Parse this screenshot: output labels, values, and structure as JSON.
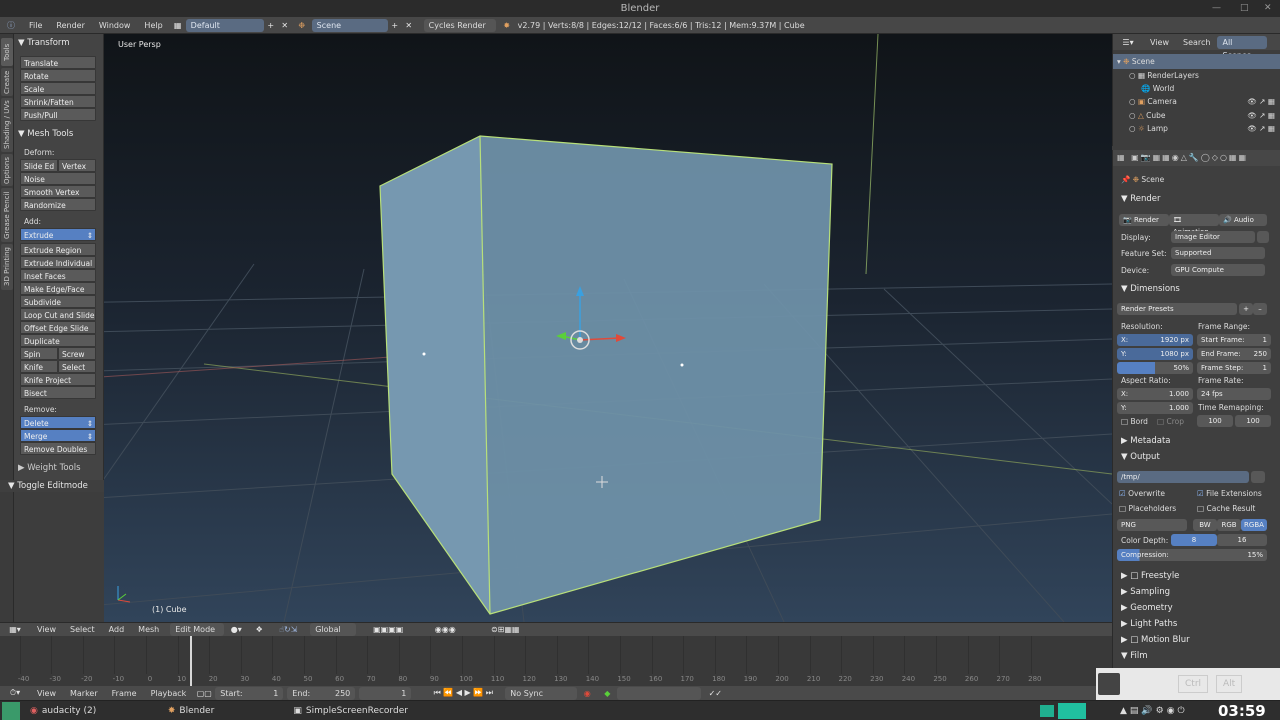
{
  "window": {
    "title": "Blender"
  },
  "infobar": {
    "menus": [
      "File",
      "Render",
      "Window",
      "Help"
    ],
    "layout": "Default",
    "scene": "Scene",
    "engine": "Cycles Render",
    "stats": "v2.79 | Verts:8/8 | Edges:12/12 | Faces:6/6 | Tris:12 | Mem:9.37M | Cube"
  },
  "left_tabs": [
    "Tools",
    "Create",
    "Shading / UVs",
    "Options",
    "Grease Pencil",
    "3D Printing"
  ],
  "toolshelf": {
    "transform_title": "Transform",
    "transform": [
      "Translate",
      "Rotate",
      "Scale",
      "Shrink/Fatten",
      "Push/Pull"
    ],
    "mesh_title": "Mesh Tools",
    "deform_label": "Deform:",
    "slide_edge": "Slide Ed",
    "vertex": "Vertex",
    "deform": [
      "Noise",
      "Smooth Vertex",
      "Randomize"
    ],
    "add_label": "Add:",
    "extrude": "Extrude",
    "add": [
      "Extrude Region",
      "Extrude Individual",
      "Inset Faces",
      "Make Edge/Face",
      "Subdivide",
      "Loop Cut and Slide",
      "Offset Edge Slide",
      "Duplicate"
    ],
    "spin": "Spin",
    "screw": "Screw",
    "knife": "Knife",
    "select": "Select",
    "more": [
      "Knife Project",
      "Bisect"
    ],
    "remove_label": "Remove:",
    "delete": "Delete",
    "merge": "Merge",
    "remove_doubles": "Remove Doubles",
    "weight_tools": "Weight Tools",
    "toggle_editmode": "Toggle Editmode"
  },
  "viewport": {
    "view_name": "User Persp",
    "object_label": "(1) Cube"
  },
  "view_header": {
    "menus": [
      "View",
      "Select",
      "Add",
      "Mesh"
    ],
    "mode": "Edit Mode",
    "orientation": "Global"
  },
  "timeline": {
    "ticks": [
      "-50",
      "-40",
      "-30",
      "-20",
      "-10",
      "0",
      "10",
      "20",
      "30",
      "40",
      "50",
      "60",
      "70",
      "80",
      "90",
      "100",
      "110",
      "120",
      "130",
      "140",
      "150",
      "160",
      "170",
      "180",
      "190",
      "200",
      "210",
      "220",
      "230",
      "240",
      "250",
      "260",
      "270",
      "280"
    ],
    "current_frame": 1
  },
  "timeline_header": {
    "menus": [
      "View",
      "Marker",
      "Frame",
      "Playback"
    ],
    "start_label": "Start:",
    "start": "1",
    "end_label": "End:",
    "end": "250",
    "current": "1",
    "sync": "No Sync"
  },
  "outliner": {
    "menus": [
      "View",
      "Search"
    ],
    "filter": "All Scenes",
    "items": [
      {
        "label": "Scene"
      },
      {
        "label": "RenderLayers"
      },
      {
        "label": "World"
      },
      {
        "label": "Camera"
      },
      {
        "label": "Cube"
      },
      {
        "label": "Lamp"
      }
    ]
  },
  "properties": {
    "breadcrumb": "Scene",
    "render_title": "Render",
    "render_btn": "Render",
    "animation_btn": "Animation",
    "audio_btn": "Audio",
    "display_label": "Display:",
    "display_value": "Image Editor",
    "feature_label": "Feature Set:",
    "feature_value": "Supported",
    "device_label": "Device:",
    "device_value": "GPU Compute",
    "dimensions_title": "Dimensions",
    "presets": "Render Presets",
    "resolution_label": "Resolution:",
    "res_x": "X:",
    "res_x_val": "1920 px",
    "res_y": "Y:",
    "res_y_val": "1080 px",
    "res_pct": "50%",
    "frame_range_label": "Frame Range:",
    "start_frame": "Start Frame:",
    "start_frame_val": "1",
    "end_frame": "End Frame:",
    "end_frame_val": "250",
    "frame_step": "Frame Step:",
    "frame_step_val": "1",
    "aspect_label": "Aspect Ratio:",
    "aspect_x": "X:",
    "aspect_x_val": "1.000",
    "aspect_y": "Y:",
    "aspect_y_val": "1.000",
    "frame_rate_label": "Frame Rate:",
    "fps": "24 fps",
    "time_remap_label": "Time Remapping:",
    "remap_old": "100",
    "remap_new": "100",
    "bord": "Bord",
    "crop": "Crop",
    "metadata_title": "Metadata",
    "output_title": "Output",
    "output_path": "/tmp/",
    "overwrite": "Overwrite",
    "file_ext": "File Extensions",
    "placeholders": "Placeholders",
    "cache_result": "Cache Result",
    "format": "PNG",
    "bw": "BW",
    "rgb": "RGB",
    "rgba": "RGBA",
    "color_depth_label": "Color Depth:",
    "depth8": "8",
    "depth16": "16",
    "compression_label": "Compression:",
    "compression_val": "15%",
    "collapsed": [
      "Freestyle",
      "Sampling",
      "Geometry",
      "Light Paths",
      "Motion Blur"
    ],
    "film_title": "Film"
  },
  "taskbar": {
    "items": [
      "audacity (2)",
      "Blender",
      "SimpleScreenRecorder"
    ],
    "kbd": [
      "Ctrl",
      "Alt"
    ],
    "clock": "03:59"
  },
  "colors": {
    "accent": "#5680c2",
    "selection_edge": "#b8e07a",
    "cube_face": "#6e90a8"
  }
}
